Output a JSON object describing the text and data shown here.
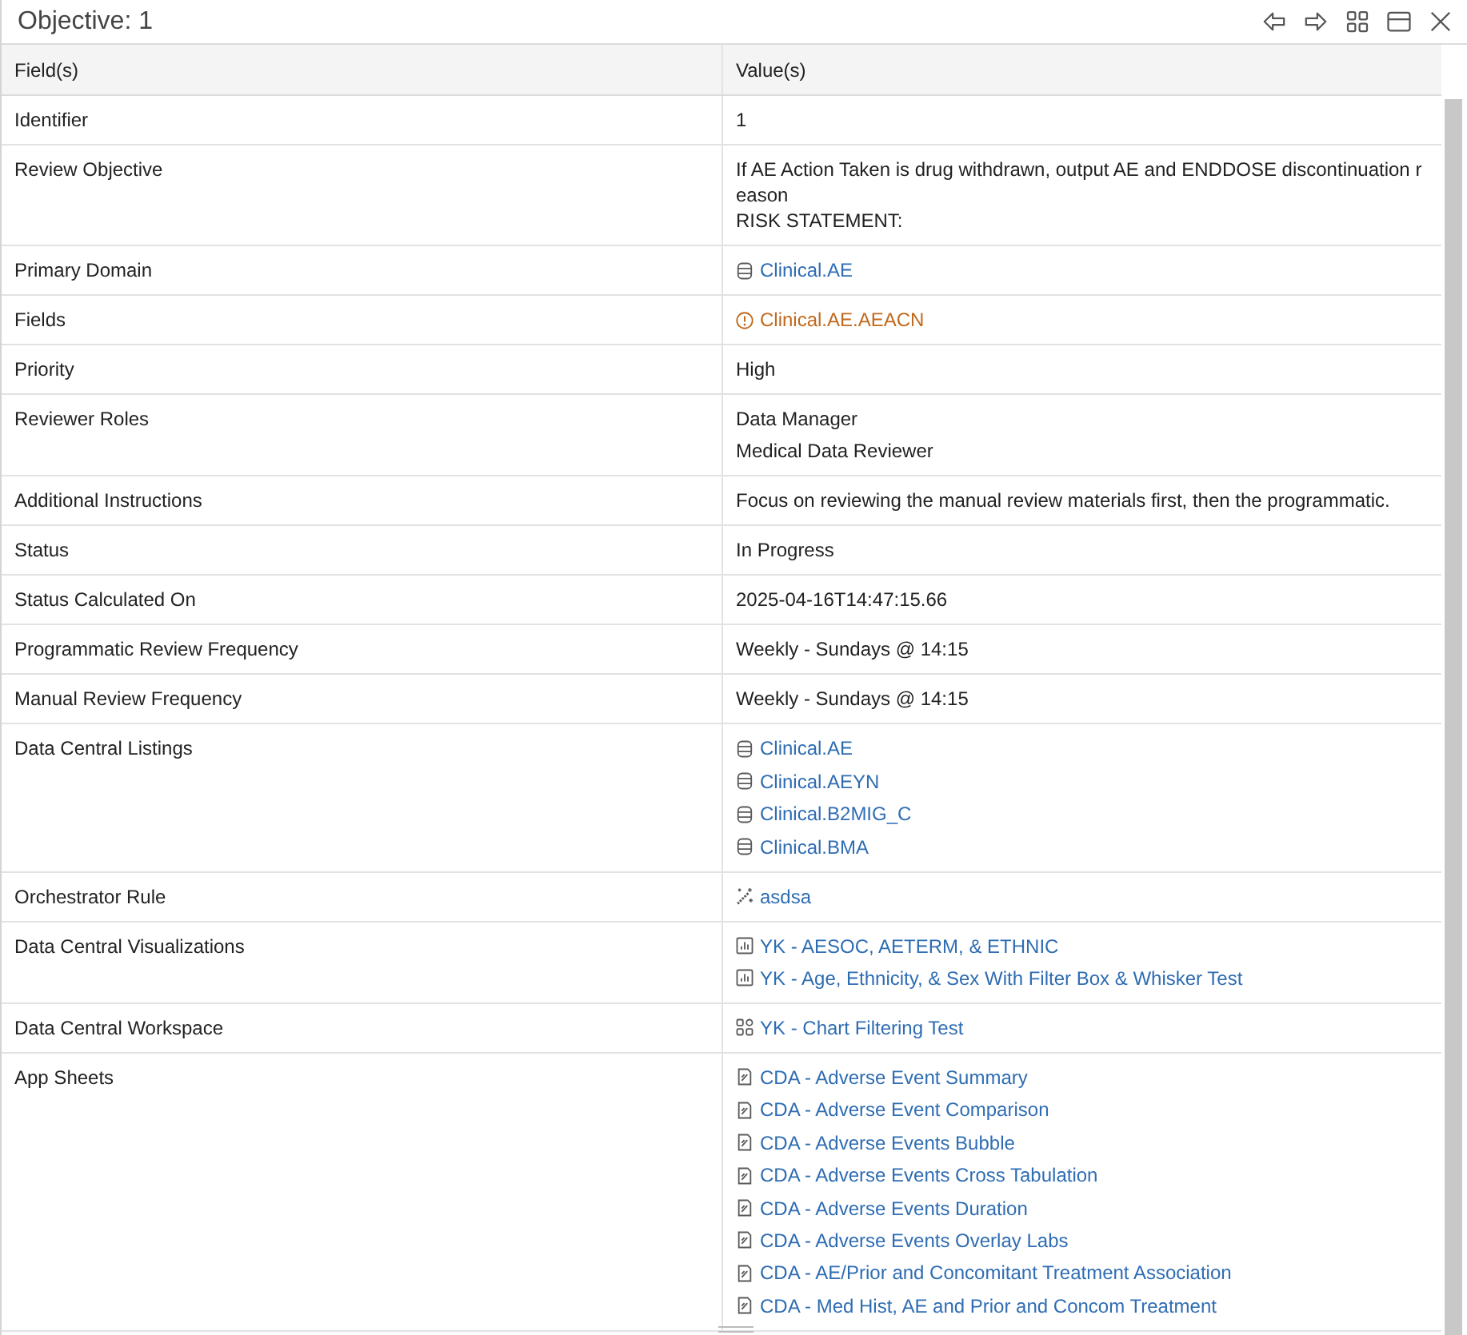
{
  "window": {
    "title": "Objective: 1"
  },
  "table": {
    "columns": [
      "Field(s)",
      "Value(s)"
    ],
    "rows": [
      {
        "field": "Identifier",
        "values": [
          {
            "kind": "text",
            "text": "1"
          }
        ]
      },
      {
        "field": "Review Objective",
        "values": [
          {
            "kind": "text",
            "text": "If AE Action Taken is drug withdrawn, output AE and ENDDOSE discontinuation reason\nRISK STATEMENT:"
          }
        ]
      },
      {
        "field": "Primary Domain",
        "values": [
          {
            "kind": "dataset",
            "text": "Clinical.AE"
          }
        ]
      },
      {
        "field": "Fields",
        "values": [
          {
            "kind": "warning",
            "text": "Clinical.AE.AEACN"
          }
        ]
      },
      {
        "field": "Priority",
        "values": [
          {
            "kind": "text",
            "text": "High"
          }
        ]
      },
      {
        "field": "Reviewer Roles",
        "values": [
          {
            "kind": "text",
            "text": "Data Manager"
          },
          {
            "kind": "text",
            "text": "Medical Data Reviewer"
          }
        ]
      },
      {
        "field": "Additional Instructions",
        "values": [
          {
            "kind": "text",
            "text": "Focus on reviewing the manual review materials first, then the programmatic."
          }
        ]
      },
      {
        "field": "Status",
        "values": [
          {
            "kind": "text",
            "text": "In Progress"
          }
        ]
      },
      {
        "field": "Status Calculated On",
        "values": [
          {
            "kind": "text",
            "text": "2025-04-16T14:47:15.66"
          }
        ]
      },
      {
        "field": "Programmatic Review Frequency",
        "values": [
          {
            "kind": "text",
            "text": "Weekly - Sundays @ 14:15"
          }
        ]
      },
      {
        "field": "Manual Review Frequency",
        "values": [
          {
            "kind": "text",
            "text": "Weekly - Sundays @ 14:15"
          }
        ]
      },
      {
        "field": "Data Central Listings",
        "values": [
          {
            "kind": "dataset",
            "text": "Clinical.AE"
          },
          {
            "kind": "dataset",
            "text": "Clinical.AEYN"
          },
          {
            "kind": "dataset",
            "text": "Clinical.B2MIG_C"
          },
          {
            "kind": "dataset",
            "text": "Clinical.BMA"
          }
        ]
      },
      {
        "field": "Orchestrator Rule",
        "values": [
          {
            "kind": "rule",
            "text": "asdsa"
          }
        ]
      },
      {
        "field": "Data Central Visualizations",
        "values": [
          {
            "kind": "chart",
            "text": "YK - AESOC, AETERM, & ETHNIC"
          },
          {
            "kind": "chart",
            "text": "YK - Age, Ethnicity, & Sex With Filter Box & Whisker Test"
          }
        ]
      },
      {
        "field": "Data Central Workspace",
        "values": [
          {
            "kind": "workspace",
            "text": "YK - Chart Filtering Test"
          }
        ]
      },
      {
        "field": "App Sheets",
        "values": [
          {
            "kind": "sheet",
            "text": "CDA - Adverse Event Summary"
          },
          {
            "kind": "sheet",
            "text": "CDA - Adverse Event Comparison"
          },
          {
            "kind": "sheet",
            "text": "CDA - Adverse Events Bubble"
          },
          {
            "kind": "sheet",
            "text": "CDA - Adverse Events Cross Tabulation"
          },
          {
            "kind": "sheet",
            "text": "CDA - Adverse Events Duration"
          },
          {
            "kind": "sheet",
            "text": "CDA - Adverse Events Overlay Labs"
          },
          {
            "kind": "sheet",
            "text": "CDA - AE/Prior and Concomitant Treatment Association"
          },
          {
            "kind": "sheet",
            "text": "CDA - Med Hist, AE and Prior and Concom Treatment"
          }
        ]
      }
    ]
  }
}
